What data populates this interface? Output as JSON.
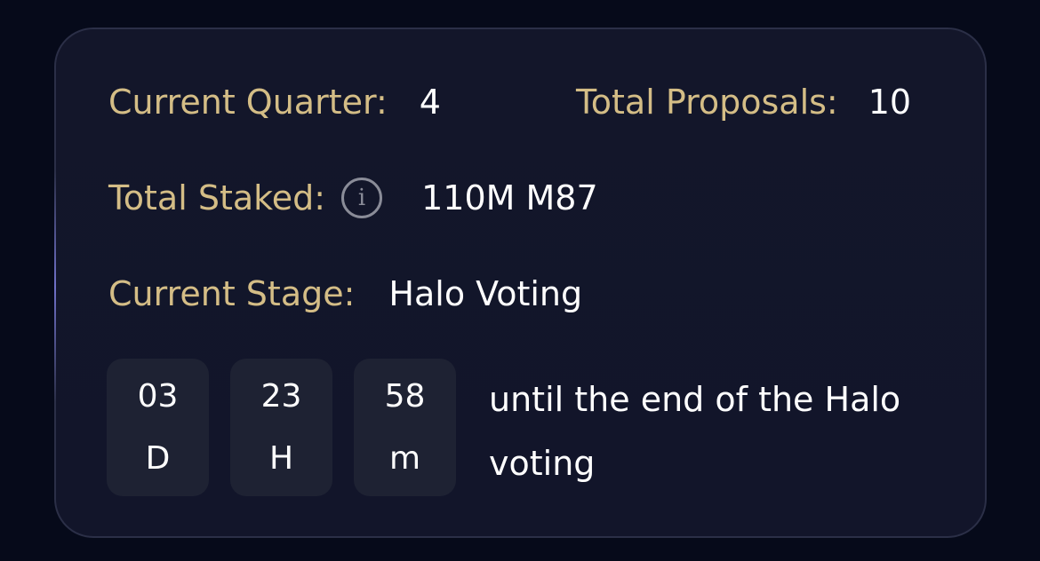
{
  "stats": {
    "current_quarter_label": "Current Quarter:",
    "current_quarter_value": "4",
    "total_proposals_label": "Total Proposals:",
    "total_proposals_value": "10",
    "total_staked_label": "Total Staked:",
    "total_staked_value": "110M M87",
    "current_stage_label": "Current Stage:",
    "current_stage_value": "Halo Voting"
  },
  "icons": {
    "info": "info-icon",
    "info_glyph": "i"
  },
  "countdown": {
    "days": "03",
    "days_unit": "D",
    "hours": "23",
    "hours_unit": "H",
    "minutes": "58",
    "minutes_unit": "m",
    "caption": "until the end of the Halo voting"
  },
  "colors": {
    "background": "#060a1a",
    "card": "#13162a",
    "label": "#d4bd86",
    "value": "#ffffff",
    "timer_box": "#1e2233"
  }
}
